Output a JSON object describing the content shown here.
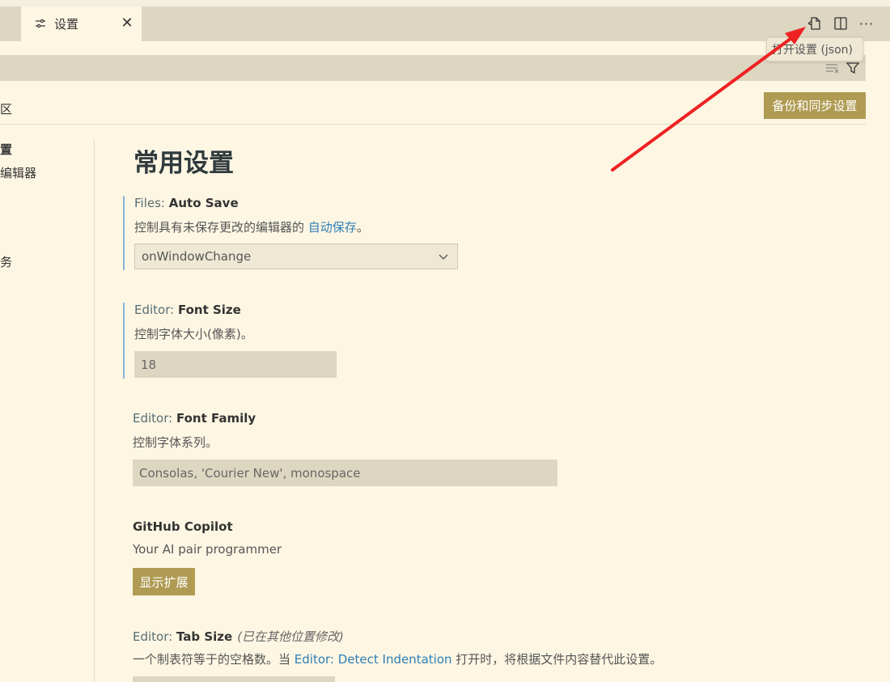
{
  "tab": {
    "label": "设置",
    "close": "✕",
    "icon": "settings-sliders-icon"
  },
  "actions": {
    "open_json_icon": "open-settings-json-icon",
    "split_icon": "split-editor-icon",
    "more": "···"
  },
  "tooltip": {
    "text": "打开设置 (json)"
  },
  "search": {
    "placeholder": ""
  },
  "scope": {
    "label": "区"
  },
  "backup_button": {
    "label": "备份和同步设置"
  },
  "toc": [
    {
      "label": "置"
    },
    {
      "label": "编辑器"
    },
    {
      "label": "务"
    }
  ],
  "section": {
    "title": "常用设置"
  },
  "settings": {
    "auto_save": {
      "category": "Files: ",
      "key": "Auto Save",
      "desc_before": "控制具有未保存更改的编辑器的 ",
      "desc_link": "自动保存",
      "desc_after": "。",
      "value": "onWindowChange"
    },
    "font_size": {
      "category": "Editor: ",
      "key": "Font Size",
      "desc": "控制字体大小(像素)。",
      "value": "18"
    },
    "font_family": {
      "category": "Editor: ",
      "key": "Font Family",
      "desc": "控制字体系列。",
      "value": "Consolas, 'Courier New', monospace"
    },
    "copilot": {
      "key": "GitHub Copilot",
      "desc": "Your AI pair programmer",
      "button": "显示扩展"
    },
    "tab_size": {
      "category": "Editor: ",
      "key": "Tab Size",
      "note": "(已在其他位置修改)",
      "desc_before": "一个制表符等于的空格数。当 ",
      "desc_link": "Editor: Detect Indentation",
      "desc_after": " 打开时，将根据文件内容替代此设置。"
    }
  },
  "colors": {
    "accent_button": "#b09b52",
    "background": "#fdf6e3",
    "arrow": "#ee2222",
    "link": "#2f7fb6"
  }
}
